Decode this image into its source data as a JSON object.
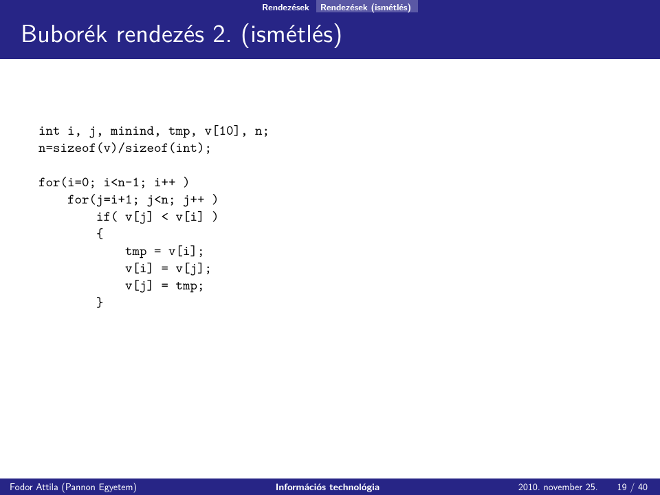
{
  "breadcrumb": {
    "level1": "Rendezések",
    "level2": "Rendezések (ismétlés)"
  },
  "title": "Buborék rendezés 2. (ismétlés)",
  "code": {
    "l1": "int i, j, minind, tmp, v[10], n;",
    "l2": "n=sizeof(v)/sizeof(int);",
    "l3": "",
    "l4": "for(i=0; i<n-1; i++ )",
    "l5": "    for(j=i+1; j<n; j++ )",
    "l6": "        if( v[j] < v[i] )",
    "l7": "        {",
    "l8": "            tmp = v[i];",
    "l9": "            v[i] = v[j];",
    "l10": "            v[j] = tmp;",
    "l11": "        }"
  },
  "footer": {
    "author": "Fodor Attila (Pannon Egyetem)",
    "course": "Információs technológia",
    "date": "2010. november 25.",
    "page": "19 / 40"
  }
}
